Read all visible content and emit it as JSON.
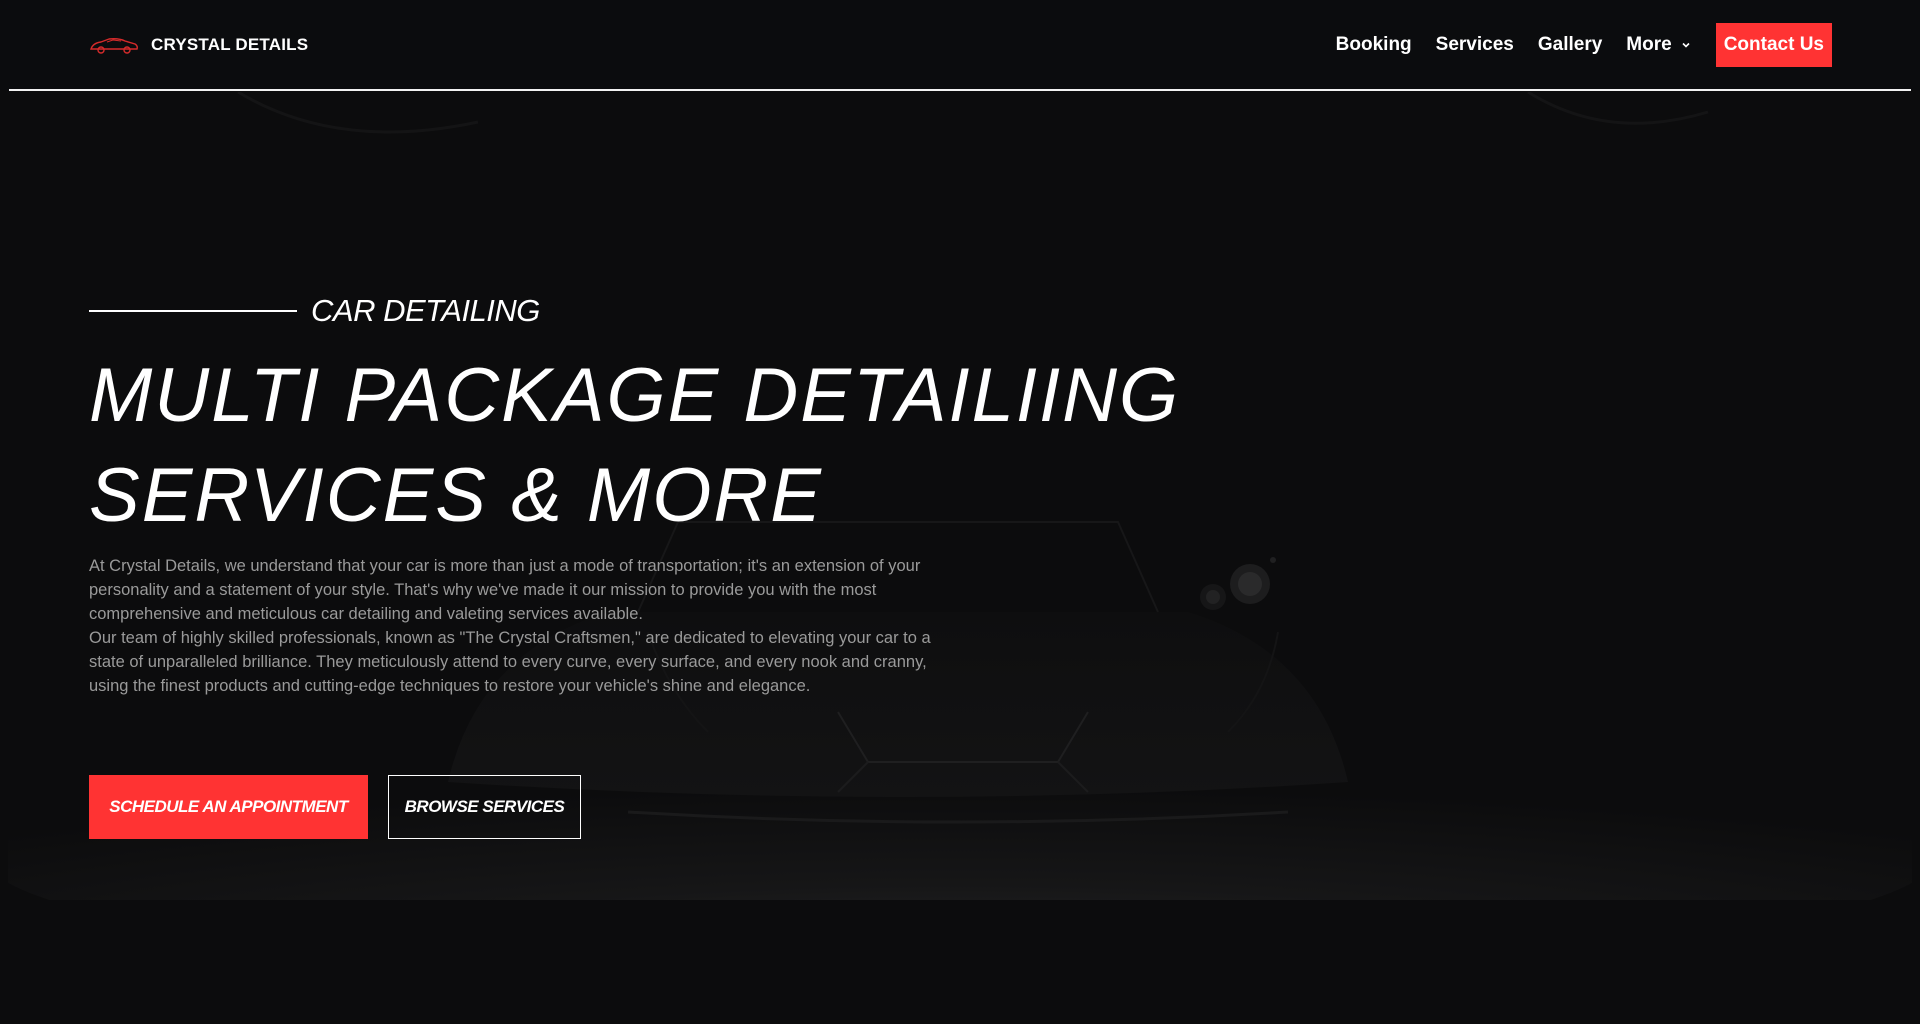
{
  "colors": {
    "background": "#0c0c0d",
    "accent": "#ff3333",
    "text": "#ffffff",
    "muted_text": "#9a9a9a"
  },
  "header": {
    "brand_name": "CRYSTAL DETAILS",
    "logo_icon": "sports-car-icon",
    "nav": {
      "booking": "Booking",
      "services": "Services",
      "gallery": "Gallery",
      "more": "More",
      "contact": "Contact Us"
    }
  },
  "hero": {
    "background_image": "dark-sports-car-front",
    "eyebrow": "CAR DETAILING",
    "headline_line1": "MULTI PACKAGE DETAILIING",
    "headline_line2": "SERVICES & MORE",
    "paragraph1": "At Crystal Details, we understand that your car is more than just a mode of transportation; it's an extension of your personality and a statement of your style. That's why we've made it our mission to provide you with the most comprehensive and meticulous car detailing and valeting services available.",
    "paragraph2": "Our team of highly skilled professionals, known as \"The Crystal Craftsmen,\" are dedicated to elevating your car to a state of unparalleled brilliance. They meticulously attend to every curve, every surface, and every nook and cranny, using the finest products and cutting-edge techniques to restore your vehicle's shine and elegance.",
    "primary_button": "SCHEDULE AN APPOINTMENT",
    "secondary_button": "BROWSE SERVICES"
  }
}
